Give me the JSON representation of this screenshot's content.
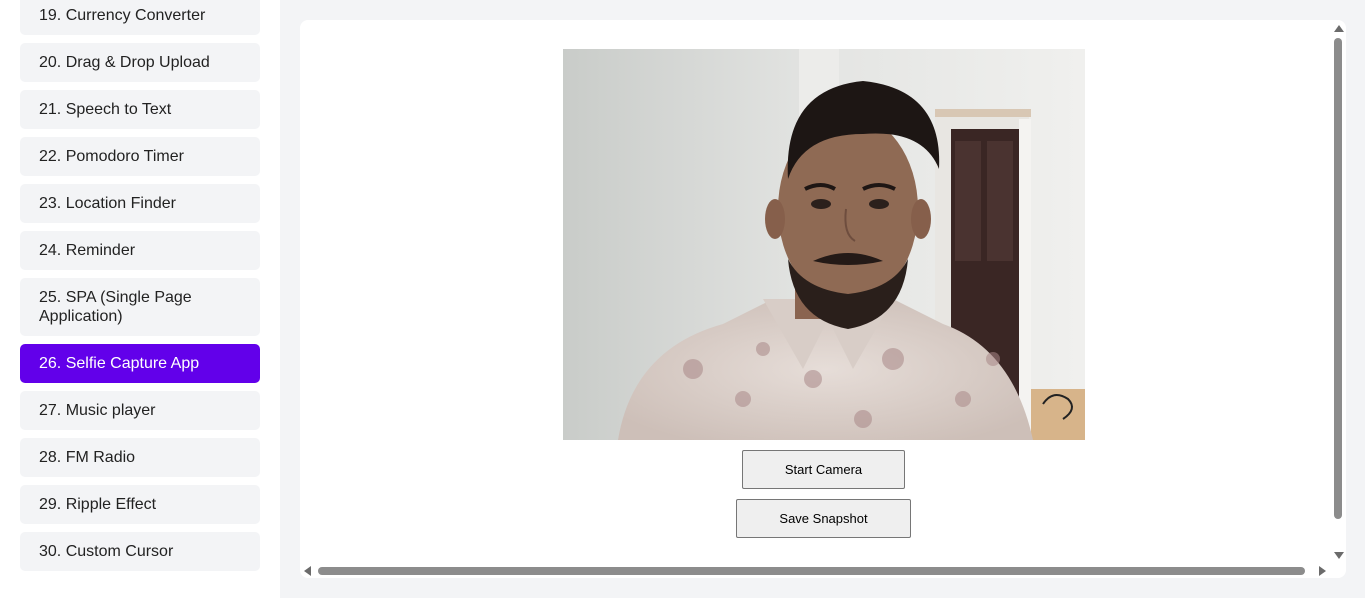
{
  "sidebar": {
    "items": [
      {
        "label": "19. Currency Converter"
      },
      {
        "label": "20. Drag & Drop Upload"
      },
      {
        "label": "21. Speech to Text"
      },
      {
        "label": "22. Pomodoro Timer"
      },
      {
        "label": "23. Location Finder"
      },
      {
        "label": "24. Reminder"
      },
      {
        "label": "25. SPA (Single Page Application)"
      },
      {
        "label": "26. Selfie Capture App"
      },
      {
        "label": "27. Music player"
      },
      {
        "label": "28. FM Radio"
      },
      {
        "label": "29. Ripple Effect"
      },
      {
        "label": "30. Custom Cursor"
      }
    ],
    "active_index": 7,
    "active_color": "#6200ea"
  },
  "main": {
    "buttons": {
      "start_camera": "Start Camera",
      "save_snapshot": "Save Snapshot"
    }
  },
  "colors": {
    "main_bg": "#f3f4f6",
    "panel_bg": "#ffffff",
    "nav_bg": "#f3f4f6"
  }
}
